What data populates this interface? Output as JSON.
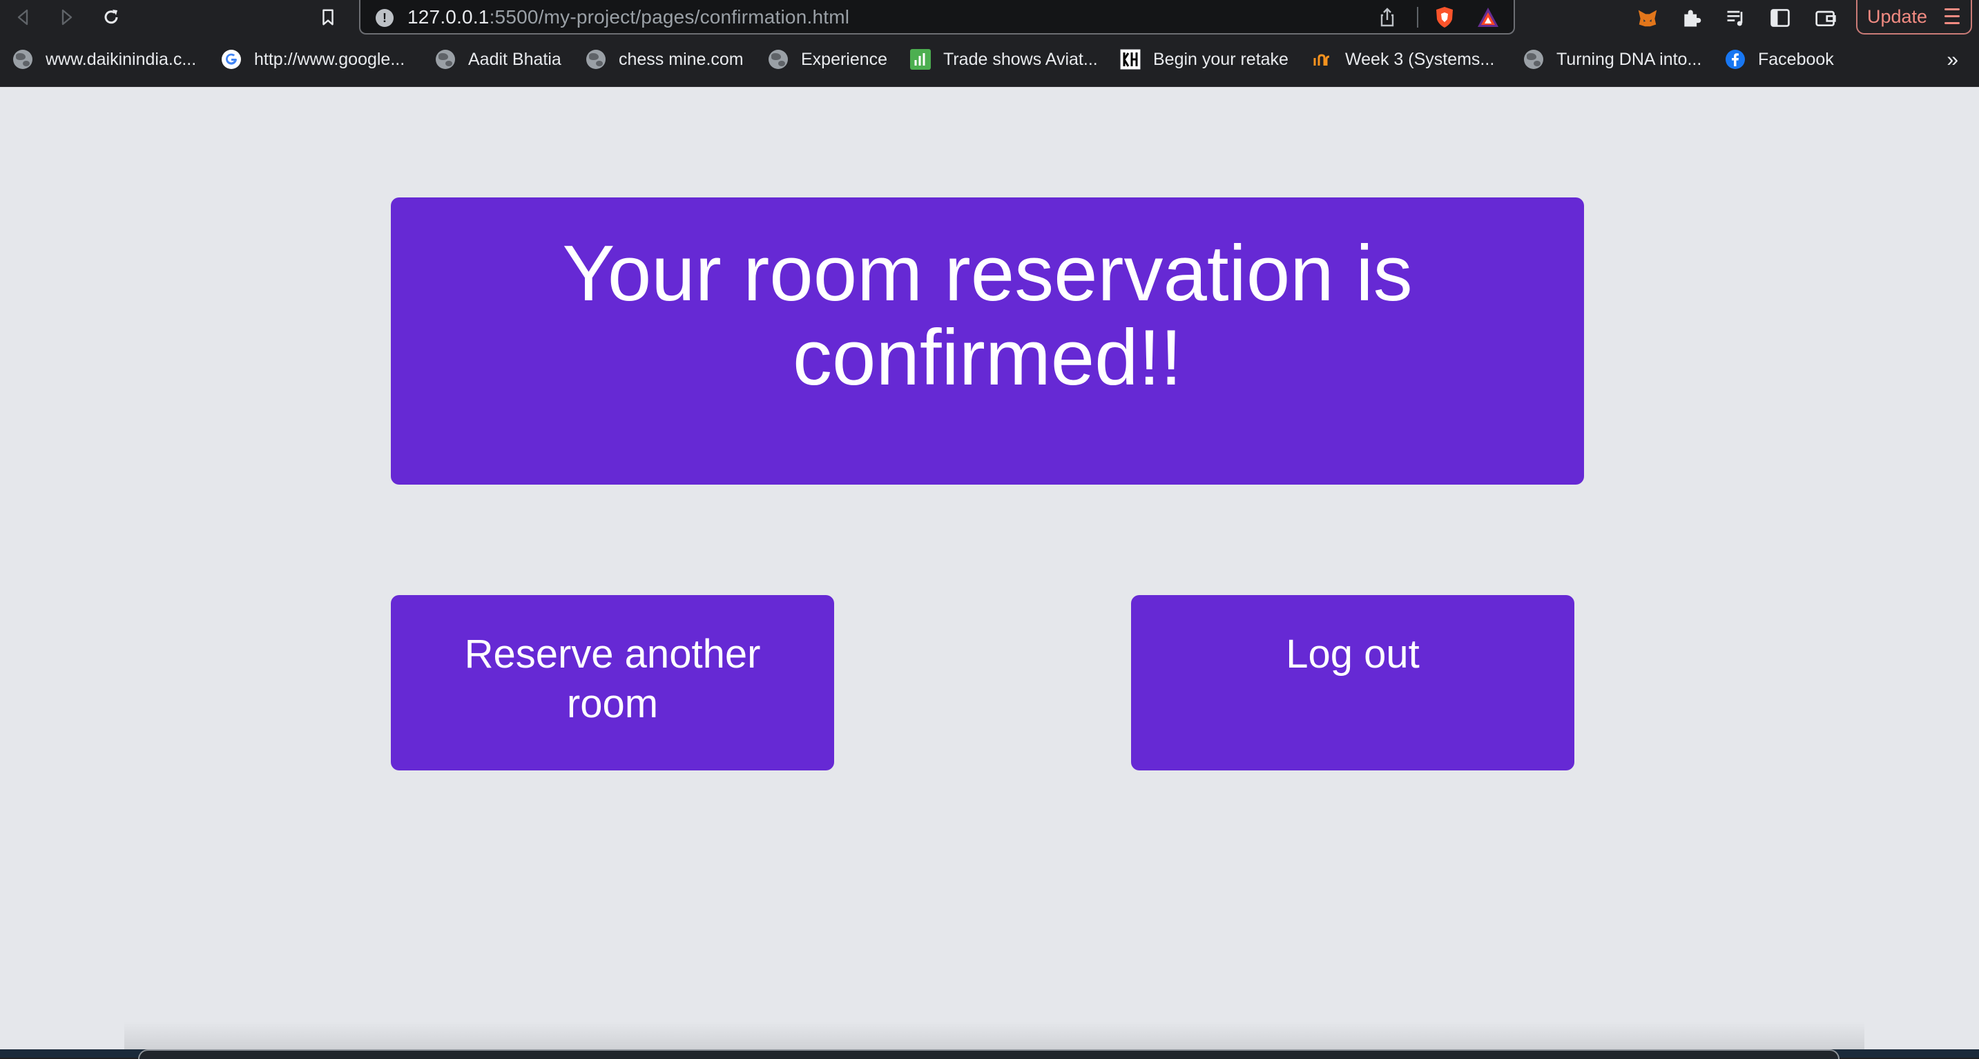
{
  "browser": {
    "url_host": "127.0.0.1",
    "url_rest": ":5500/my-project/pages/confirmation.html",
    "update_label": "Update",
    "bookmarks_more": "»",
    "bookmarks": [
      {
        "label": "www.daikinindia.c...",
        "icon": "globe-icon"
      },
      {
        "label": "http://www.google...",
        "icon": "google-icon"
      },
      {
        "label": "Aadit Bhatia",
        "icon": "globe-icon"
      },
      {
        "label": "chess mine.com",
        "icon": "globe-icon"
      },
      {
        "label": "Experience",
        "icon": "globe-icon"
      },
      {
        "label": "Trade shows Aviat...",
        "icon": "chart-icon"
      },
      {
        "label": "Begin your retake",
        "icon": "kh-icon"
      },
      {
        "label": "Week 3 (Systems...",
        "icon": "coursera-icon"
      },
      {
        "label": "Turning DNA into...",
        "icon": "globe-icon"
      },
      {
        "label": "Facebook",
        "icon": "facebook-icon"
      }
    ]
  },
  "page": {
    "confirmation_title": "Your room reservation is confirmed!!",
    "reserve_button": "Reserve another room",
    "logout_button": "Log out"
  },
  "colors": {
    "accent": "#6629d4",
    "page_bg": "#e5e7eb",
    "toolbar_bg": "#202124"
  }
}
